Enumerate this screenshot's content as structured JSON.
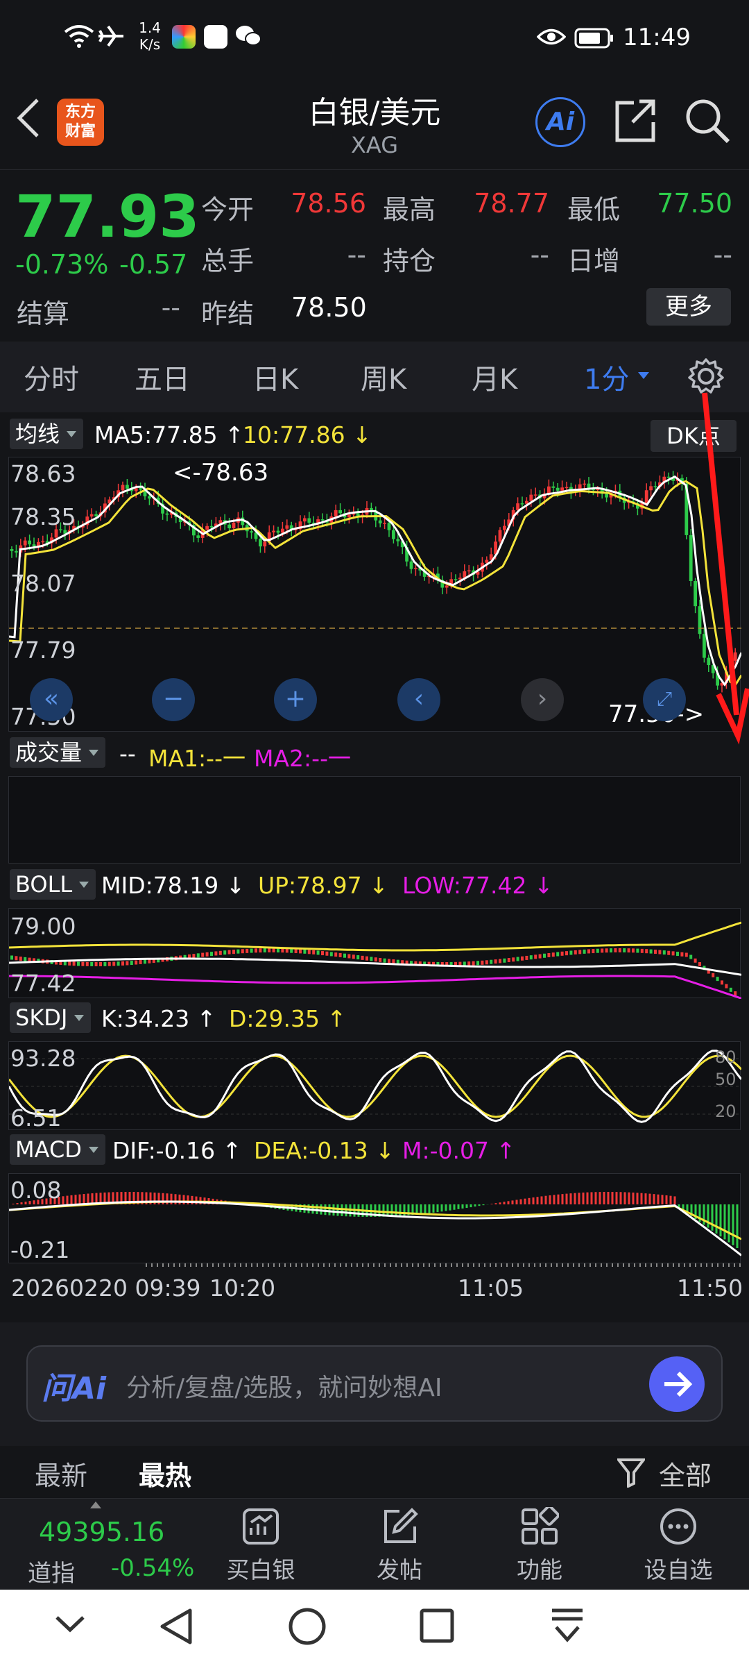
{
  "status_bar": {
    "net_speed_value": "1.4",
    "net_speed_unit": "K/s",
    "time": "11:49"
  },
  "header": {
    "logo_line1": "东方",
    "logo_line2": "财富",
    "title": "白银/美元",
    "code": "XAG",
    "ai_label": "Ai"
  },
  "quote": {
    "price": "77.93",
    "change_pct": "-0.73%",
    "change": "-0.57",
    "fields": {
      "open_label": "今开",
      "open": "78.56",
      "high_label": "最高",
      "high": "78.77",
      "low_label": "最低",
      "low": "77.50",
      "volume_label": "总手",
      "volume": "--",
      "oi_label": "持仓",
      "oi": "--",
      "daily_add_label": "日增",
      "daily_add": "--",
      "settle_label": "结算",
      "settle": "--",
      "prev_settle_label": "昨结",
      "prev_settle": "78.50"
    },
    "more_label": "更多"
  },
  "tabs": [
    {
      "label": "分时"
    },
    {
      "label": "五日"
    },
    {
      "label": "日K"
    },
    {
      "label": "周K"
    },
    {
      "label": "月K"
    },
    {
      "label": "1分"
    }
  ],
  "main_chart": {
    "indicator_btn": "均线",
    "ma5": "MA5:77.85",
    "ma10": "10:77.86",
    "dk_label": "DK点",
    "y_ticks": [
      "78.63",
      "78.35",
      "78.07",
      "77.79",
      "77.50"
    ],
    "high_marker": "<-78.63",
    "low_marker": "77.50->"
  },
  "volume_panel": {
    "indicator_btn": "成交量",
    "value": "--",
    "ma1": "MA1:--一",
    "ma2": "MA2:--一"
  },
  "boll_panel": {
    "indicator_btn": "BOLL",
    "mid": "MID:78.19",
    "up": "UP:78.97",
    "low": "LOW:77.42",
    "y_top": "79.00",
    "y_bottom": "77.42"
  },
  "skdj_panel": {
    "indicator_btn": "SKDJ",
    "k": "K:34.23",
    "d": "D:29.35",
    "y_top": "93.28",
    "y_bottom": "6.51",
    "r_80": "80",
    "r_50": "50",
    "r_20": "20"
  },
  "macd_panel": {
    "indicator_btn": "MACD",
    "dif": "DIF:-0.16",
    "dea": "DEA:-0.13",
    "m": "M:-0.07",
    "y_top": "0.08",
    "y_bottom": "-0.21"
  },
  "time_axis": {
    "start": "20260220 09:39",
    "t1": "10:20",
    "t2": "11:05",
    "t3": "11:50"
  },
  "ai_bar": {
    "logo": "问Ai",
    "placeholder": "分析/复盘/选股，就问妙想AI"
  },
  "news_tabs": {
    "latest": "最新",
    "hot": "最热",
    "filter": "全部"
  },
  "bottom_bar": {
    "index_value": "49395.16",
    "index_name": "道指",
    "index_change": "-0.54%",
    "buy": "买白银",
    "post": "发帖",
    "func": "功能",
    "watch": "设自选"
  },
  "colors": {
    "up": "#f03838",
    "down": "#2dcb4a",
    "ma5": "#ffffff",
    "ma10": "#f3e33a",
    "magenta": "#e61ee6",
    "accent": "#3e7cf0",
    "annotation_arrow": "#ff1a1a"
  }
}
